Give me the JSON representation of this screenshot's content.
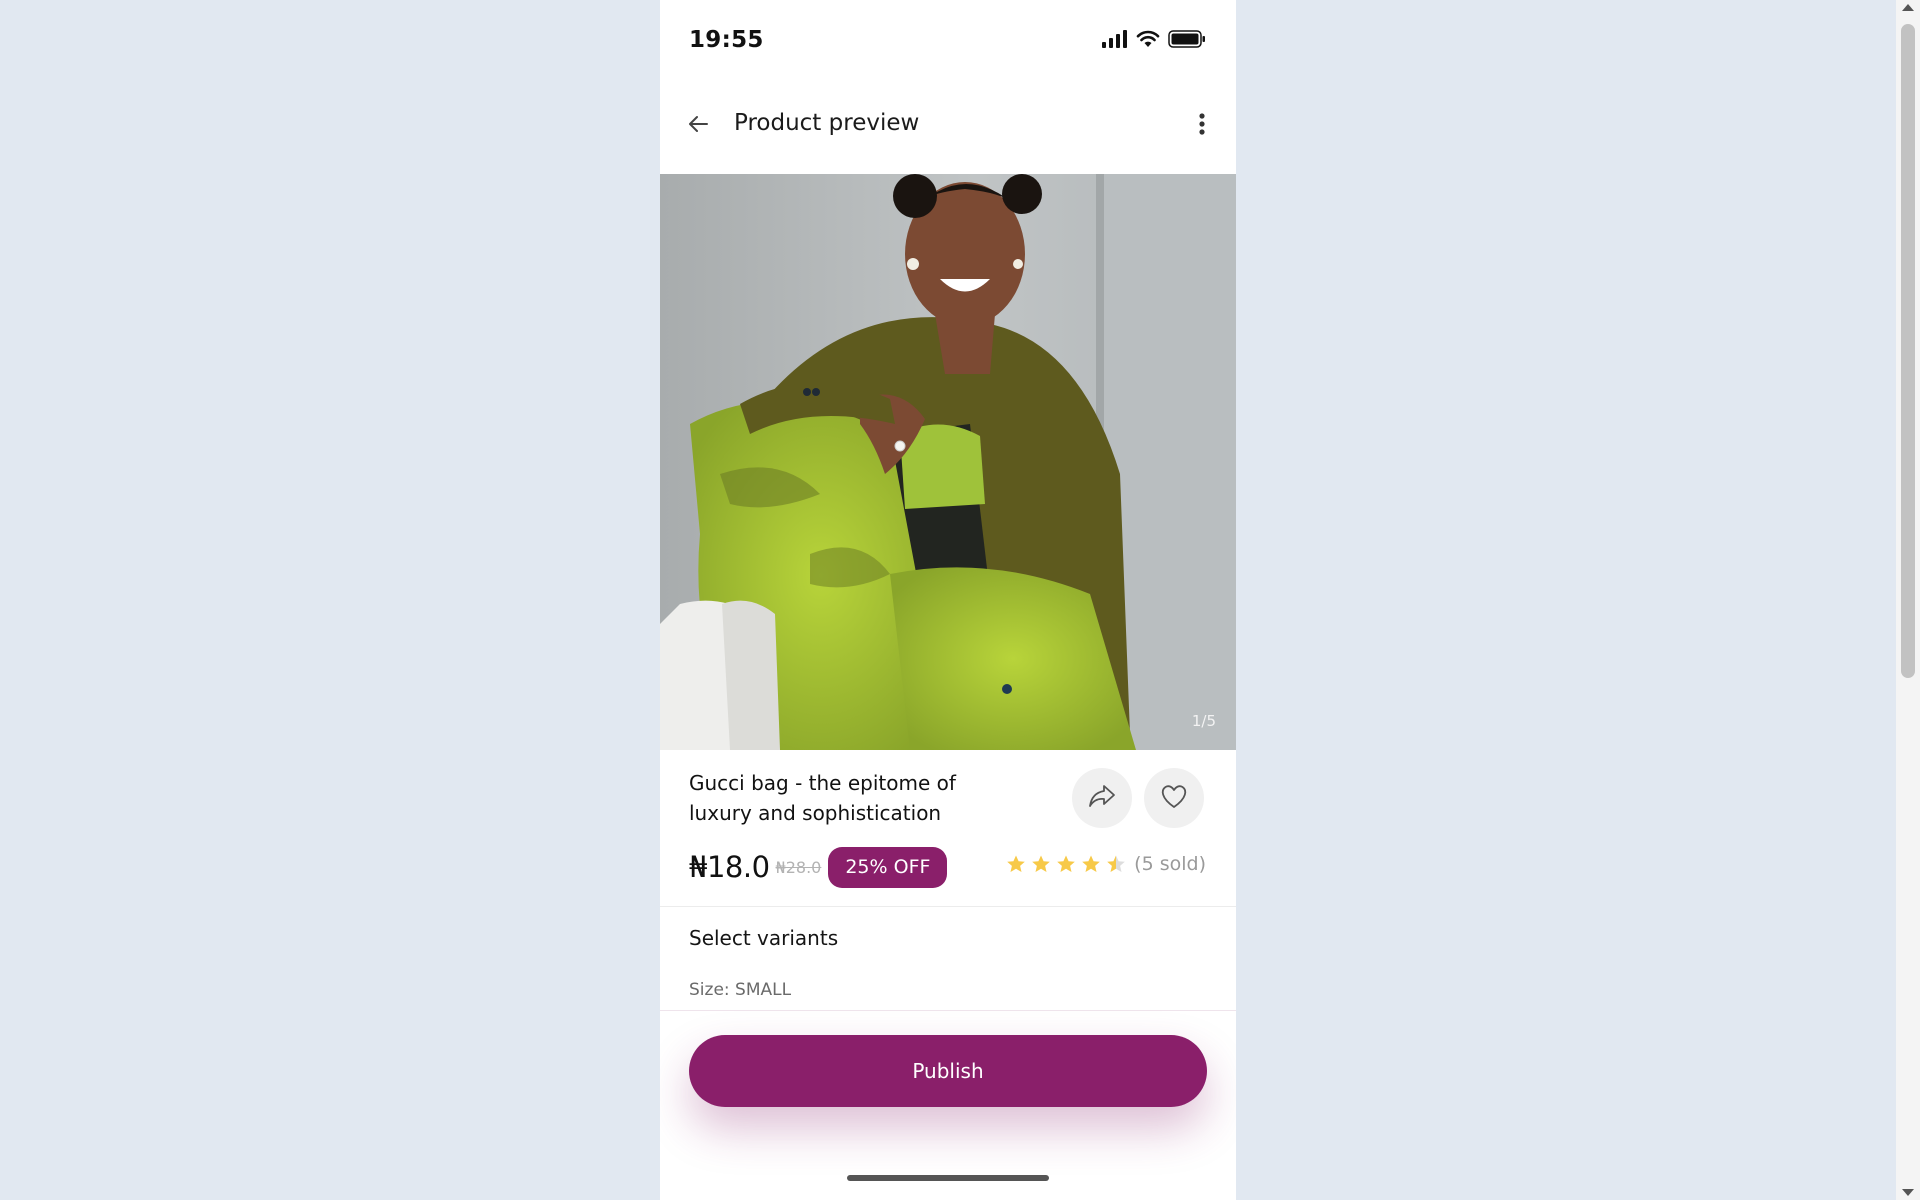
{
  "status_bar": {
    "time": "19:55",
    "icons": [
      "cellular-signal-icon",
      "wifi-icon",
      "battery-icon"
    ]
  },
  "app_bar": {
    "title": "Product preview",
    "back_icon": "arrow-left-icon",
    "menu_icon": "more-vertical-icon"
  },
  "gallery": {
    "counter": "1/5"
  },
  "product": {
    "title": "Gucci bag - the epitome of luxury and sophistication",
    "price": "₦18.0",
    "old_price": "₦28.0",
    "discount": "25% OFF",
    "rating": 4.5,
    "sold": "(5 sold)",
    "share_icon": "share-arrow-icon",
    "favorite_icon": "heart-icon"
  },
  "variants": {
    "title": "Select variants",
    "size": "Size: SMALL"
  },
  "actions": {
    "publish_label": "Publish"
  },
  "colors": {
    "accent": "#8a1f6a",
    "star": "#f7c948",
    "background": "#e1e8f1"
  }
}
